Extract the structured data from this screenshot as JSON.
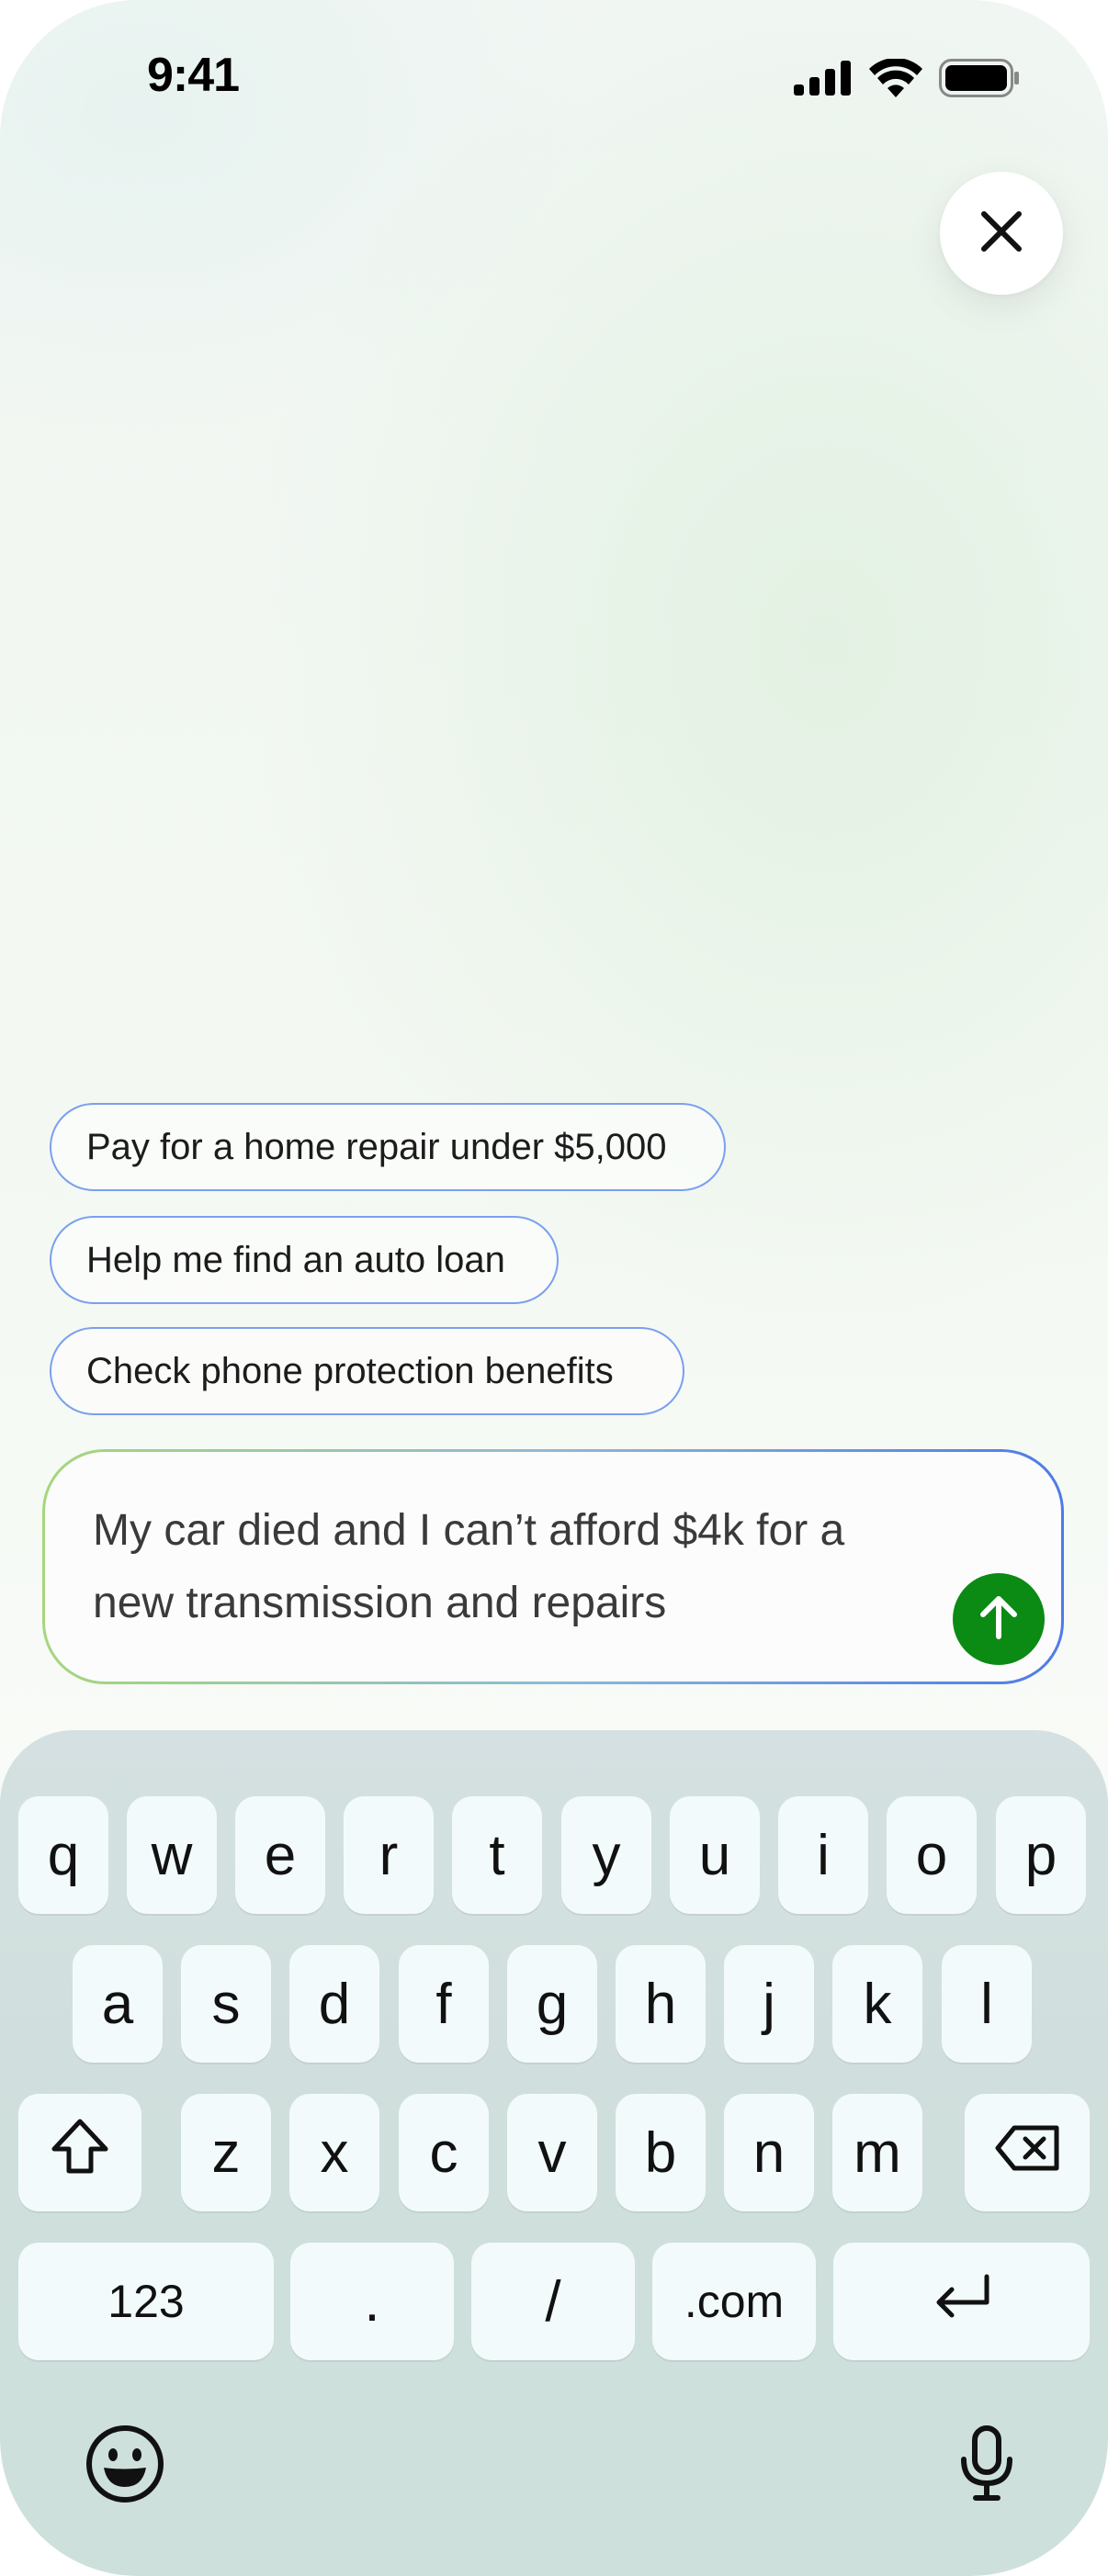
{
  "status_bar": {
    "time": "9:41"
  },
  "suggestions": [
    {
      "label": "Pay for a home repair under $5,000"
    },
    {
      "label": "Help me find an auto loan"
    },
    {
      "label": "Check phone protection benefits"
    }
  ],
  "composer": {
    "value": "My car died and I can’t afford $4k for a new transmission and repairs",
    "send_icon": "arrow-up-icon"
  },
  "keyboard": {
    "row1": [
      "q",
      "w",
      "e",
      "r",
      "t",
      "y",
      "u",
      "i",
      "o",
      "p"
    ],
    "row2": [
      "a",
      "s",
      "d",
      "f",
      "g",
      "h",
      "j",
      "k",
      "l"
    ],
    "row3": [
      "z",
      "x",
      "c",
      "v",
      "b",
      "n",
      "m"
    ],
    "row4": [
      "123",
      ".",
      "/",
      ".com"
    ],
    "icons": [
      "shift-icon",
      "backspace-icon",
      "return-icon",
      "emoji-icon",
      "microphone-icon"
    ]
  },
  "colors": {
    "chip_border": "#7b9ff0",
    "send_button": "#0b8a14",
    "keyboard_bg": "#d1dfde"
  }
}
